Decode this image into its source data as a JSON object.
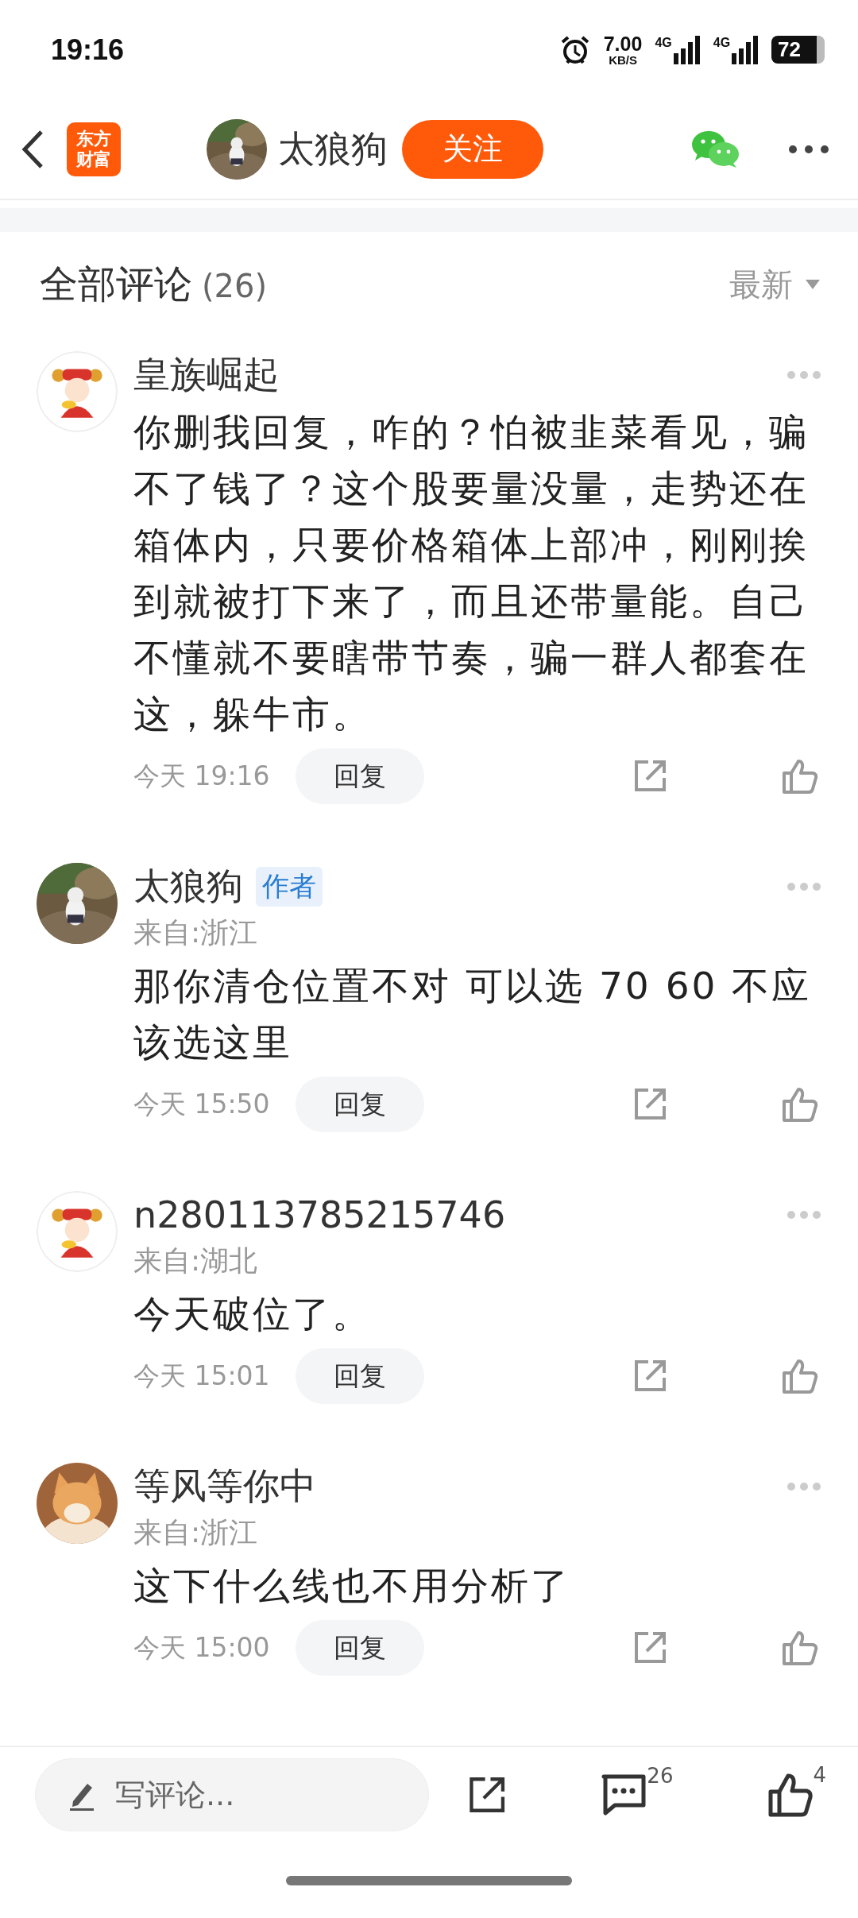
{
  "status_bar": {
    "time": "19:16",
    "net_speed": "7.00",
    "net_unit": "KB/S",
    "sim_1": "4G",
    "sim_2": "4G",
    "battery": "72"
  },
  "header": {
    "logo_lines": [
      "东方",
      "财富"
    ],
    "author": "太狼狗",
    "follow_button": "关注"
  },
  "comments_header": {
    "title": "全部评论",
    "count": "(26)",
    "sort": "最新"
  },
  "comments": [
    {
      "name": "皇族崛起",
      "text": "你删我回复，咋的？怕被韭菜看见，骗不了钱了？这个股要量没量，走势还在箱体内，只要价格箱体上部冲，刚刚挨到就被打下来了，而且还带量能。自己不懂就不要瞎带节奏，骗一群人都套在这，躲牛市。",
      "time": "今天 19:16",
      "reply": "回复"
    },
    {
      "name": "太狼狗",
      "badge": "作者",
      "location": "来自:浙江",
      "text": "那你清仓位置不对 可以选 70 60 不应该选这里",
      "time": "今天 15:50",
      "reply": "回复"
    },
    {
      "name": "n280113785215746",
      "location": "来自:湖北",
      "text": "今天破位了。",
      "time": "今天 15:01",
      "reply": "回复"
    },
    {
      "name": "等风等你中",
      "location": "来自:浙江",
      "text": "这下什么线也不用分析了",
      "time": "今天 15:00",
      "reply": "回复"
    }
  ],
  "bottom_bar": {
    "placeholder": "写评论...",
    "comment_count": "26",
    "like_count": "4"
  }
}
